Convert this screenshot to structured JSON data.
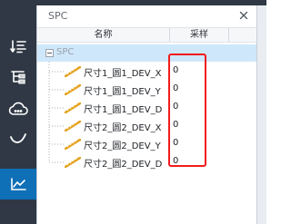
{
  "panel": {
    "title": "SPC",
    "columns": {
      "name": "名称",
      "sample": "采样"
    },
    "root": {
      "label": "SPC",
      "expanded": true
    },
    "rows": [
      {
        "name": "尺寸1_圆1_DEV_X",
        "sample": "0"
      },
      {
        "name": "尺寸1_圆1_DEV_Y",
        "sample": "0"
      },
      {
        "name": "尺寸1_圆1_DEV_D",
        "sample": "0"
      },
      {
        "name": "尺寸2_圆2_DEV_X",
        "sample": "0"
      },
      {
        "name": "尺寸2_圆2_DEV_Y",
        "sample": "0"
      },
      {
        "name": "尺寸2_圆2_DEV_D",
        "sample": "0"
      }
    ]
  },
  "sidebar": {
    "items": [
      {
        "icon": "sort-list-icon"
      },
      {
        "icon": "tree-structure-icon"
      },
      {
        "icon": "cloud-settings-icon"
      },
      {
        "icon": "curve-icon"
      },
      {
        "icon": "line-chart-icon",
        "active": true
      }
    ]
  },
  "colors": {
    "sidebar": "#2f3844",
    "sidebar_active": "#0f6fb7",
    "selected_row": "#cfe7fa",
    "annotation_box": "#f21b1b",
    "leaf_icon": "#e5a31f"
  }
}
